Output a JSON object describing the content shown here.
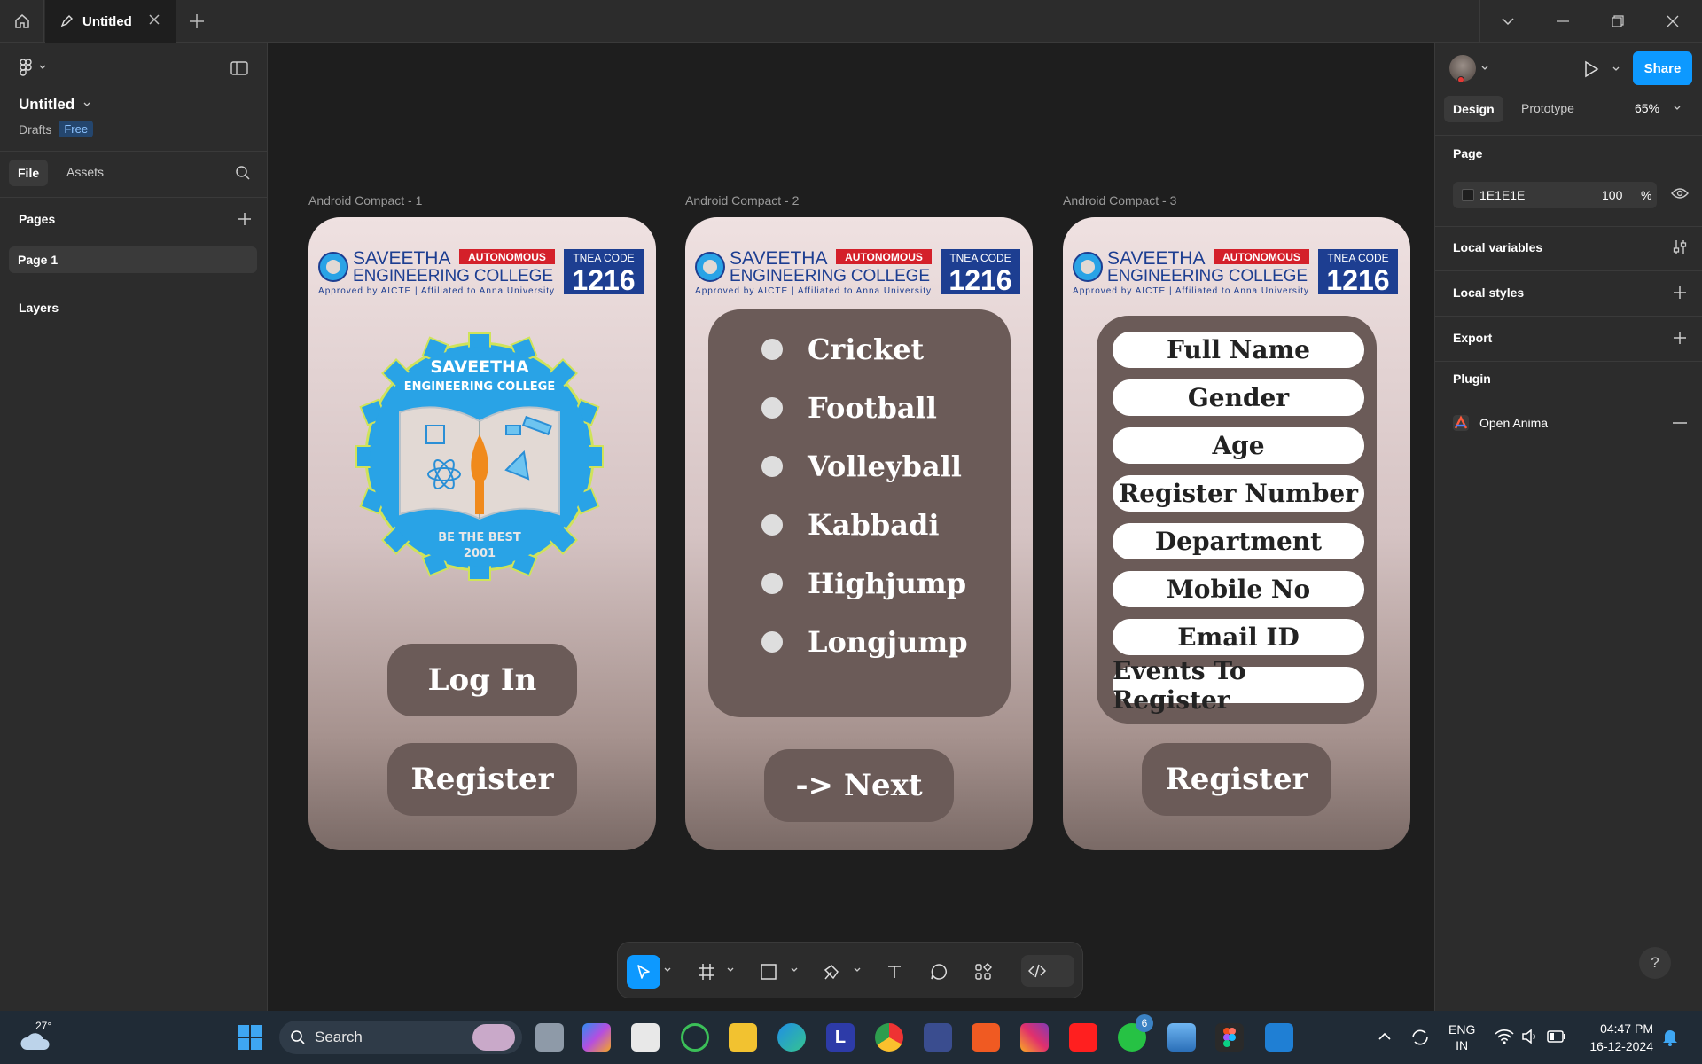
{
  "app": {
    "tab_title": "Untitled",
    "file_name": "Untitled",
    "location": "Drafts",
    "plan_badge": "Free"
  },
  "left_panel": {
    "tabs": [
      "File",
      "Assets"
    ],
    "pages_header": "Pages",
    "pages": [
      "Page 1"
    ],
    "layers_header": "Layers"
  },
  "right_panel": {
    "share_label": "Share",
    "tabs": [
      "Design",
      "Prototype"
    ],
    "zoom": "65%",
    "page_header": "Page",
    "page_color": "1E1E1E",
    "page_opacity": "100",
    "opacity_unit": "%",
    "local_variables": "Local variables",
    "local_styles": "Local styles",
    "export": "Export",
    "plugin_header": "Plugin",
    "plugin_name": "Open Anima"
  },
  "frames": [
    {
      "label": "Android Compact - 1",
      "buttons": [
        "Log In",
        "Register"
      ]
    },
    {
      "label": "Android Compact - 2",
      "sports": [
        "Cricket",
        "Football",
        "Volleyball",
        "Kabbadi",
        "Highjump",
        "Longjump"
      ],
      "next_label": "-> Next"
    },
    {
      "label": "Android Compact - 3",
      "fields": [
        "Full Name",
        "Gender",
        "Age",
        "Register Number",
        "Department",
        "Mobile No",
        "Email ID",
        "Events To Register"
      ],
      "register_label": "Register"
    }
  ],
  "college_logo": {
    "name_line1": "SAVEETHA",
    "name_line2": "ENGINEERING COLLEGE",
    "badge": "AUTONOMOUS",
    "approval": "Approved by AICTE | Affiliated to Anna University",
    "code_label": "TNEA CODE",
    "code": "1216",
    "emblem_top": "SAVEETHA",
    "emblem_sub": "ENGINEERING COLLEGE",
    "emblem_motto": "BE THE BEST",
    "emblem_year": "2001"
  },
  "taskbar": {
    "weather": "27°",
    "search_placeholder": "Search",
    "notification_count": "6",
    "lang_line1": "ENG",
    "lang_line2": "IN",
    "time": "04:47 PM",
    "date": "16-12-2024"
  },
  "colors": {
    "accent": "#0d99ff",
    "canvas": "#1e1e1e",
    "panel": "#2c2c2c",
    "button_fill": "#6b5b58",
    "logo_blue": "#1d3e91",
    "logo_red": "#d4202a"
  }
}
